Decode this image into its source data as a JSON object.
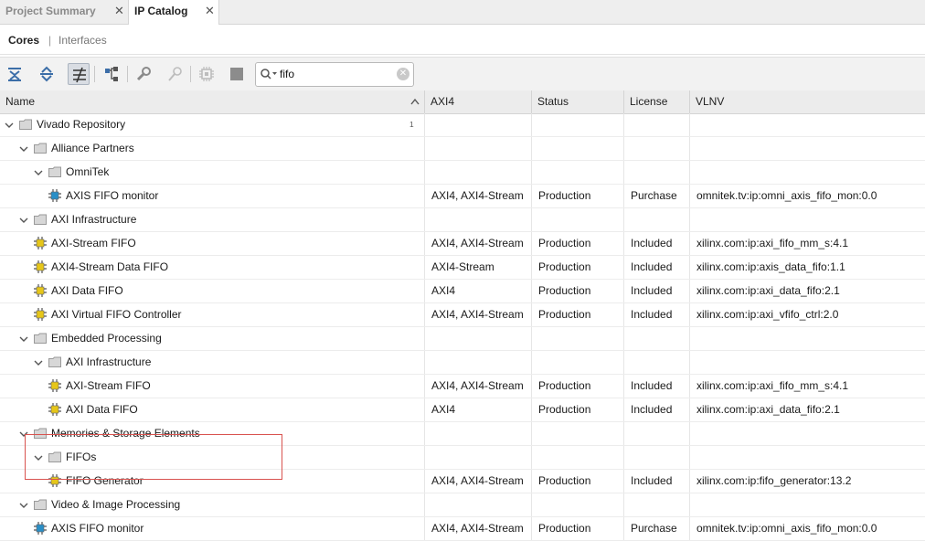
{
  "tabs": [
    {
      "label": "Project Summary",
      "active": false
    },
    {
      "label": "IP Catalog",
      "active": true
    }
  ],
  "subtabs": {
    "cores": "Cores",
    "separator": "|",
    "interfaces": "Interfaces"
  },
  "toolbar": {
    "icons": [
      "collapse-all-icon",
      "expand-all-icon",
      "filter-icon",
      "hierarchy-icon",
      "customize-ip-icon",
      "edit-ip-icon",
      "chip-icon",
      "stop-icon"
    ],
    "search_value": "fifo"
  },
  "columns": {
    "name": "Name",
    "sort_indicator": "^",
    "sort_rank": "1",
    "axi4": "AXI4",
    "status": "Status",
    "license": "License",
    "vlnv": "VLNV"
  },
  "rows": [
    {
      "level": 0,
      "kind": "folder",
      "expanded": true,
      "name": "Vivado Repository",
      "axi": "",
      "status": "",
      "license": "",
      "vlnv": ""
    },
    {
      "level": 1,
      "kind": "folder",
      "expanded": true,
      "name": "Alliance Partners",
      "axi": "",
      "status": "",
      "license": "",
      "vlnv": ""
    },
    {
      "level": 2,
      "kind": "folder",
      "expanded": true,
      "name": "OmniTek",
      "axi": "",
      "status": "",
      "license": "",
      "vlnv": ""
    },
    {
      "level": 3,
      "kind": "ip-purchase",
      "name": "AXIS FIFO monitor",
      "axi": "AXI4, AXI4-Stream",
      "status": "Production",
      "license": "Purchase",
      "vlnv": "omnitek.tv:ip:omni_axis_fifo_mon:0.0"
    },
    {
      "level": 1,
      "kind": "folder",
      "expanded": true,
      "name": "AXI Infrastructure",
      "axi": "",
      "status": "",
      "license": "",
      "vlnv": ""
    },
    {
      "level": 2,
      "kind": "ip",
      "name": "AXI-Stream FIFO",
      "axi": "AXI4, AXI4-Stream",
      "status": "Production",
      "license": "Included",
      "vlnv": "xilinx.com:ip:axi_fifo_mm_s:4.1"
    },
    {
      "level": 2,
      "kind": "ip",
      "name": "AXI4-Stream Data FIFO",
      "axi": "AXI4-Stream",
      "status": "Production",
      "license": "Included",
      "vlnv": "xilinx.com:ip:axis_data_fifo:1.1"
    },
    {
      "level": 2,
      "kind": "ip",
      "name": "AXI Data FIFO",
      "axi": "AXI4",
      "status": "Production",
      "license": "Included",
      "vlnv": "xilinx.com:ip:axi_data_fifo:2.1"
    },
    {
      "level": 2,
      "kind": "ip",
      "name": "AXI Virtual FIFO Controller",
      "axi": "AXI4, AXI4-Stream",
      "status": "Production",
      "license": "Included",
      "vlnv": "xilinx.com:ip:axi_vfifo_ctrl:2.0"
    },
    {
      "level": 1,
      "kind": "folder",
      "expanded": true,
      "name": "Embedded Processing",
      "axi": "",
      "status": "",
      "license": "",
      "vlnv": ""
    },
    {
      "level": 2,
      "kind": "folder",
      "expanded": true,
      "name": "AXI Infrastructure",
      "axi": "",
      "status": "",
      "license": "",
      "vlnv": ""
    },
    {
      "level": 3,
      "kind": "ip",
      "name": "AXI-Stream FIFO",
      "axi": "AXI4, AXI4-Stream",
      "status": "Production",
      "license": "Included",
      "vlnv": "xilinx.com:ip:axi_fifo_mm_s:4.1"
    },
    {
      "level": 3,
      "kind": "ip",
      "name": "AXI Data FIFO",
      "axi": "AXI4",
      "status": "Production",
      "license": "Included",
      "vlnv": "xilinx.com:ip:axi_data_fifo:2.1"
    },
    {
      "level": 1,
      "kind": "folder",
      "expanded": true,
      "name": "Memories & Storage Elements",
      "axi": "",
      "status": "",
      "license": "",
      "vlnv": ""
    },
    {
      "level": 2,
      "kind": "folder",
      "expanded": true,
      "name": "FIFOs",
      "axi": "",
      "status": "",
      "license": "",
      "vlnv": ""
    },
    {
      "level": 3,
      "kind": "ip",
      "name": "FIFO Generator",
      "axi": "AXI4, AXI4-Stream",
      "status": "Production",
      "license": "Included",
      "vlnv": "xilinx.com:ip:fifo_generator:13.2"
    },
    {
      "level": 1,
      "kind": "folder",
      "expanded": true,
      "name": "Video & Image Processing",
      "axi": "",
      "status": "",
      "license": "",
      "vlnv": ""
    },
    {
      "level": 2,
      "kind": "ip-purchase",
      "name": "AXIS FIFO monitor",
      "axi": "AXI4, AXI4-Stream",
      "status": "Production",
      "license": "Purchase",
      "vlnv": "omnitek.tv:ip:omni_axis_fifo_mon:0.0"
    }
  ],
  "colors": {
    "ip_included": "#e6c619",
    "ip_purchase": "#2a8fc7",
    "folder": "#d7d7d7",
    "highlight_box": "#d9534f"
  }
}
